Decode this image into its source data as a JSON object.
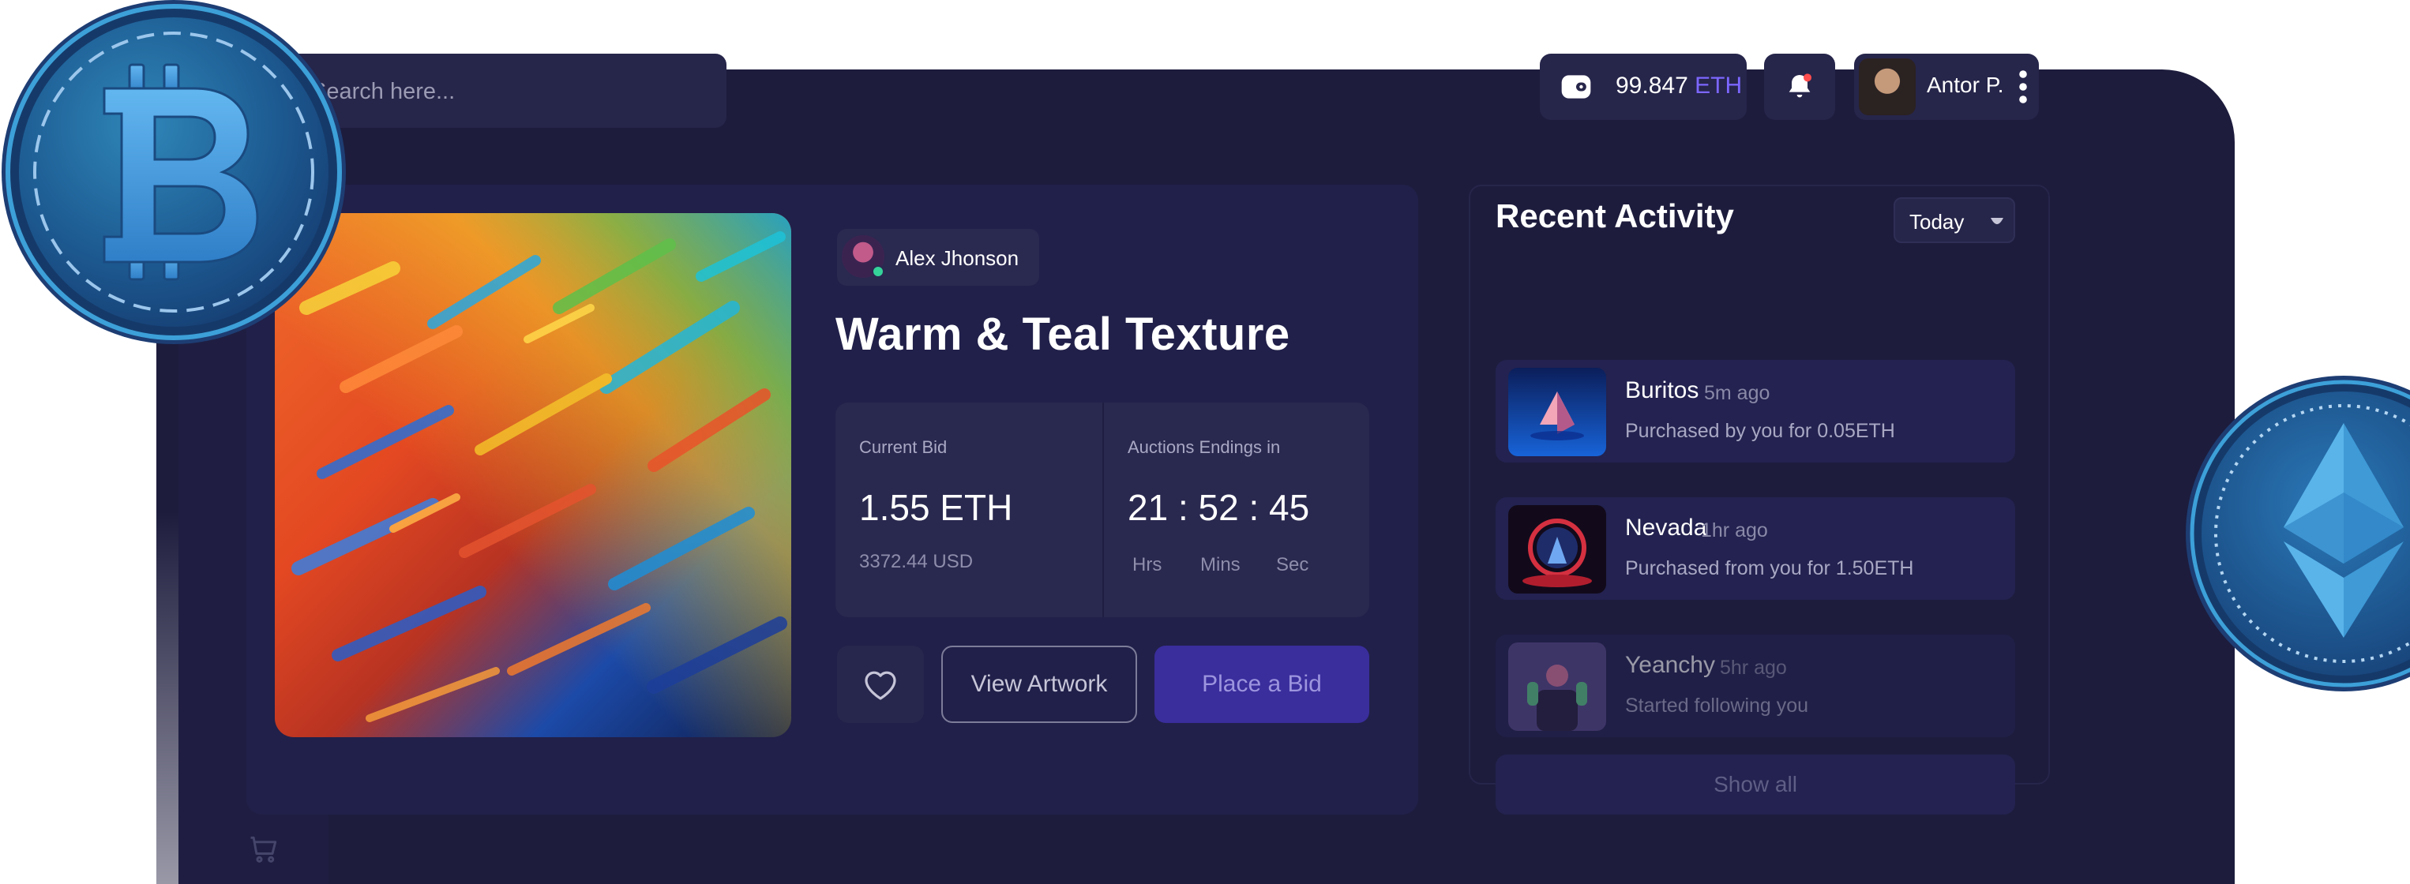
{
  "search": {
    "placeholder": "Search here..."
  },
  "wallet": {
    "amount": "99.847",
    "currency": "ETH"
  },
  "user": {
    "name": "Antor P."
  },
  "nft": {
    "creator": "Alex Jhonson",
    "title": "Warm & Teal Texture",
    "current_bid_label": "Current Bid",
    "current_bid": "1.55 ETH",
    "current_bid_usd": "3372.44 USD",
    "auction_label": "Auctions Endings in",
    "countdown": "21 : 52 : 45",
    "hrs_label": "Hrs",
    "mins_label": "Mins",
    "sec_label": "Sec",
    "view_button": "View Artwork",
    "bid_button": "Place a Bid"
  },
  "recent": {
    "title": "Recent Activity",
    "filter": "Today",
    "items": [
      {
        "name": "Buritos",
        "ago": "5m ago",
        "desc": "Purchased by you for 0.05ETH"
      },
      {
        "name": "Nevada",
        "ago": "1hr ago",
        "desc": "Purchased from you for 1.50ETH"
      },
      {
        "name": "Yeanchy",
        "ago": "5hr ago",
        "desc": "Started following you"
      }
    ],
    "show_all": "Show all"
  },
  "colors": {
    "panel": "#1d1c3d",
    "accent": "#7c67ff",
    "bid_button": "#3a2d9c",
    "online": "#35d39a",
    "notification": "#ff4d4d"
  },
  "icons": {
    "sidebar": [
      "briefcase-icon",
      "heart-icon",
      "star-icon",
      "folder-icon",
      "cart-icon"
    ],
    "topbar": [
      "search-icon",
      "wallet-icon",
      "bell-icon",
      "more-vertical-icon"
    ],
    "coins": [
      "bitcoin-icon",
      "ethereum-icon"
    ]
  }
}
